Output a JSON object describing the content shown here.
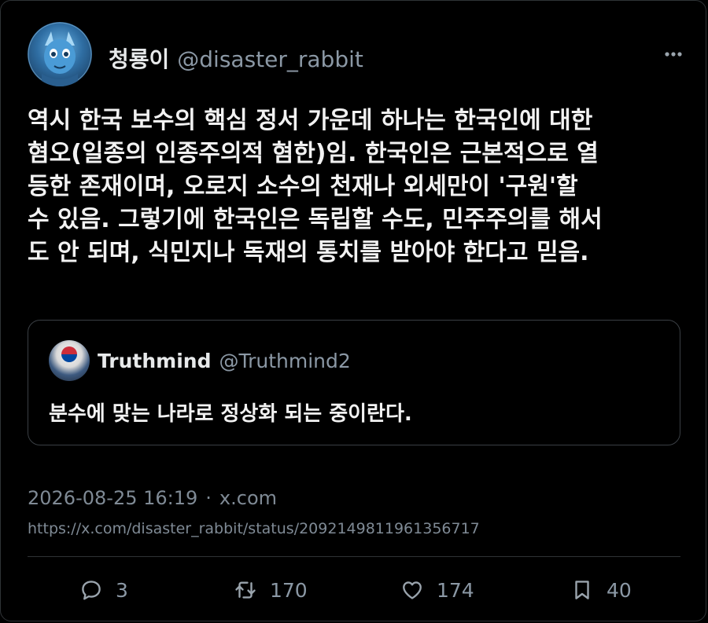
{
  "post": {
    "author_name": "청룡이",
    "author_handle": "@disaster_rabbit",
    "text": "역시 한국 보수의 핵심 정서 가운데 하나는 한국인에 대한\n혐오(일종의 인종주의적 혐한)임. 한국인은 근본적으로 열\n등한 존재이며, 오로지 소수의 천재나 외세만이 '구원'할\n수 있음. 그렇기에 한국인은 독립할 수도, 민주주의를 해서\n도 안 되며, 식민지나 독재의 통치를 받아야 한다고 믿음.",
    "more_icon": "more-icon"
  },
  "quote": {
    "author_name": "Truthmind",
    "author_handle": "@Truthmind2",
    "text": "분수에 맞는 나라로 정상화 되는 중이란다."
  },
  "meta": {
    "timestamp": "2026-08-25 16:19",
    "separator": "·",
    "source": "x.com",
    "url": "https://x.com/disaster_rabbit/status/2092149811961356717"
  },
  "actions": {
    "replies": "3",
    "reposts": "170",
    "likes": "174",
    "bookmarks": "40"
  },
  "colors": {
    "background": "#000000",
    "text": "#e7e9ea",
    "muted": "#8b98a5",
    "border": "#2f3336"
  }
}
